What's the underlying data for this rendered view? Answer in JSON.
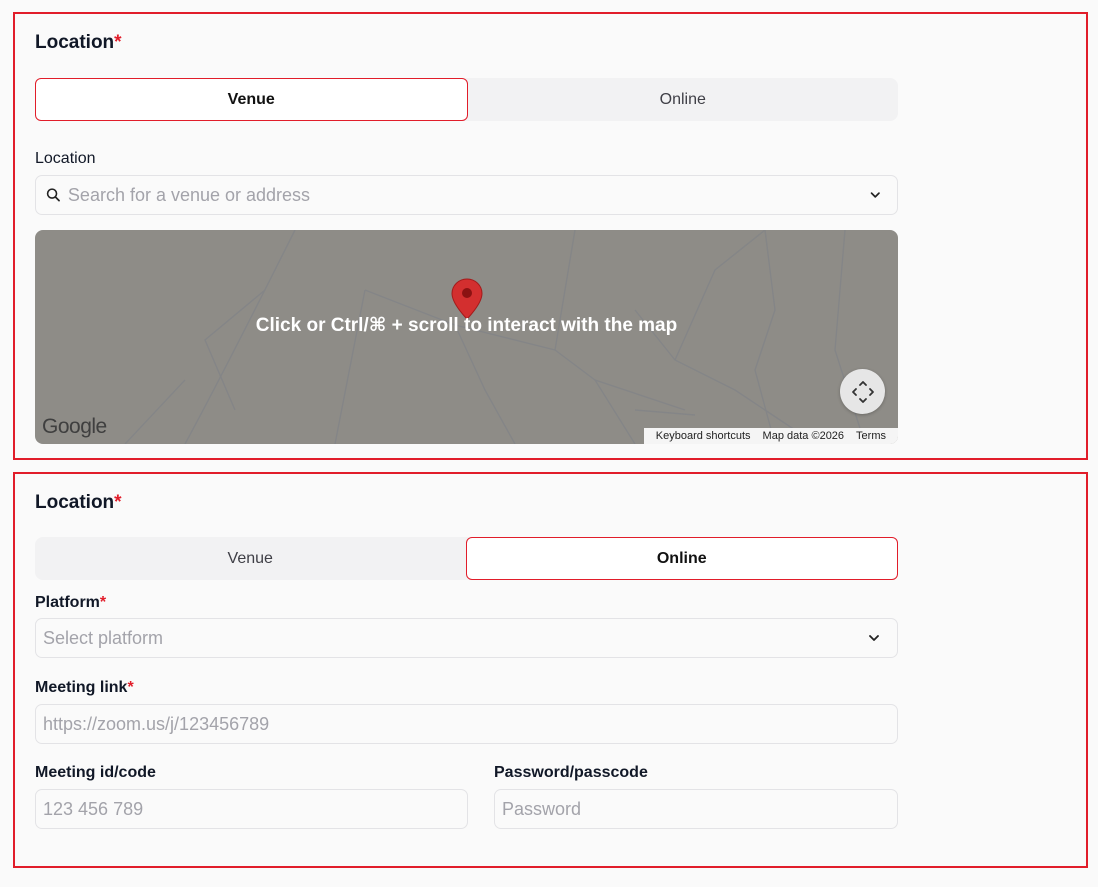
{
  "venue_panel": {
    "title": "Location",
    "required_mark": "*",
    "toggle": {
      "venue_label": "Venue",
      "online_label": "Online",
      "active": "Venue"
    },
    "location_label": "Location",
    "search": {
      "placeholder": "Search for a venue or address"
    },
    "map": {
      "overlay_text": "Click or Ctrl/⌘ + scroll to interact with the map",
      "logo": "Google",
      "attribution": [
        "Keyboard shortcuts",
        "Map data ©2026",
        "Terms"
      ]
    }
  },
  "online_panel": {
    "title": "Location",
    "required_mark": "*",
    "toggle": {
      "venue_label": "Venue",
      "online_label": "Online",
      "active": "Online"
    },
    "platform_label": "Platform",
    "platform_placeholder": "Select platform",
    "meeting_link_label": "Meeting link",
    "meeting_link_placeholder": "https://zoom.us/j/123456789",
    "meeting_id_label": "Meeting id/code",
    "meeting_id_placeholder": "123 456 789",
    "password_label": "Password/passcode",
    "password_placeholder": "Password"
  },
  "colors": {
    "accent": "#e11d2a",
    "map_bg": "#8e8c87",
    "pin": "#d32f2f"
  }
}
